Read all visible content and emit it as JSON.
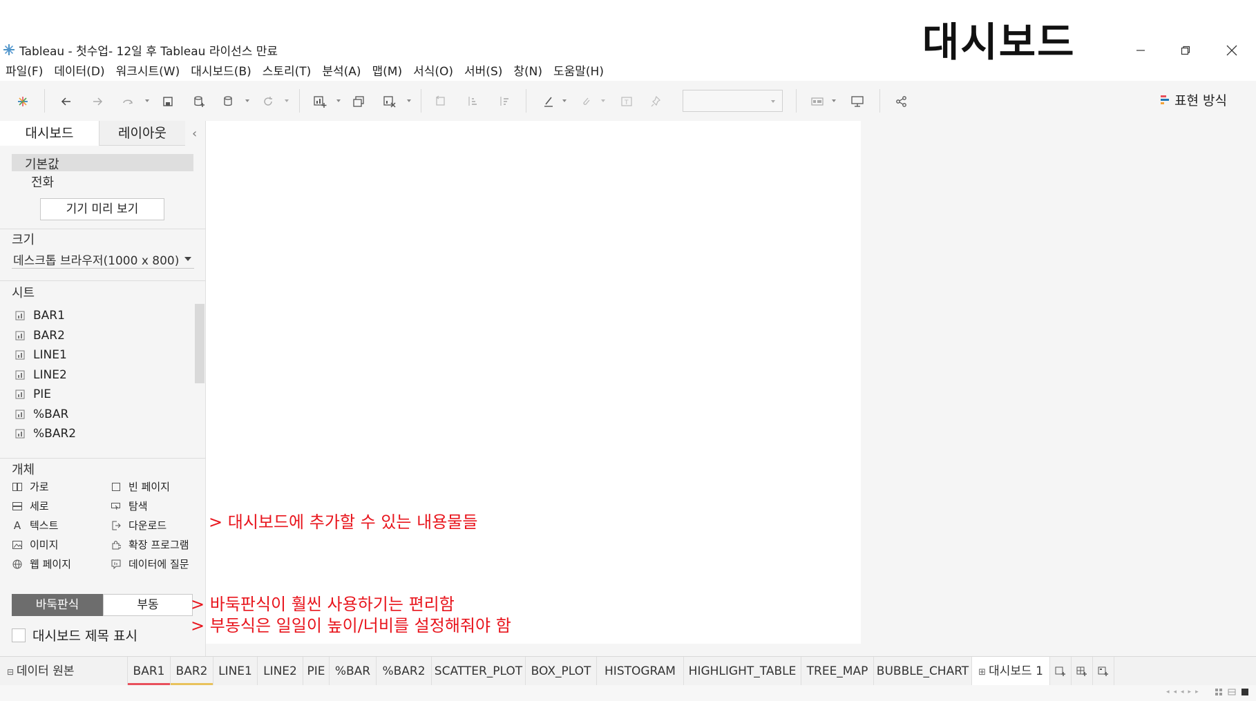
{
  "window": {
    "title": "Tableau - 첫수업- 12일 후 Tableau 라이선스 만료",
    "heading": "대시보드",
    "icons": [
      "tableau-logo-icon",
      "minimize-icon",
      "restore-icon",
      "close-icon"
    ]
  },
  "menu": [
    "파일(F)",
    "데이터(D)",
    "워크시트(W)",
    "대시보드(B)",
    "스토리(T)",
    "분석(A)",
    "맵(M)",
    "서식(O)",
    "서버(S)",
    "창(N)",
    "도움말(H)"
  ],
  "toolbar": {
    "show_me": "표현 방식"
  },
  "left_panel": {
    "tabs": [
      "대시보드",
      "레이아웃"
    ],
    "device_default": "기본값",
    "device_phone": "전화",
    "device_preview": "기기 미리 보기",
    "size_label": "크기",
    "size_value": "데스크톱 브라우저(1000 x 800)",
    "sheets_label": "시트",
    "sheets": [
      "BAR1",
      "BAR2",
      "LINE1",
      "LINE2",
      "PIE",
      "%BAR",
      "%BAR2"
    ],
    "objects_label": "개체",
    "objects": [
      {
        "label": "가로",
        "icon": "horizontal-container-icon"
      },
      {
        "label": "빈 페이지",
        "icon": "blank-icon"
      },
      {
        "label": "세로",
        "icon": "vertical-container-icon"
      },
      {
        "label": "탐색",
        "icon": "navigation-icon"
      },
      {
        "label": "텍스트",
        "icon": "text-icon"
      },
      {
        "label": "다운로드",
        "icon": "download-icon"
      },
      {
        "label": "이미지",
        "icon": "image-icon"
      },
      {
        "label": "확장 프로그램",
        "icon": "extension-icon"
      },
      {
        "label": "웹 페이지",
        "icon": "web-page-icon"
      },
      {
        "label": "데이터에 질문",
        "icon": "ask-data-icon"
      }
    ],
    "tiled": "바둑판식",
    "floating": "부동",
    "show_title": "대시보드 제목 표시"
  },
  "annotations": [
    "> 대시보드에 추가할 수 있는 내용물들",
    "> 바둑판식이 훨씬 사용하기는 편리함",
    "> 부동식은 일일이 높이/너비를 설정해줘야 함"
  ],
  "annotation_color": "#e8141c",
  "bottom_tabs": {
    "data_source": "데이터 원본",
    "sheets": [
      {
        "label": "BAR1",
        "accent": "#e8505b"
      },
      {
        "label": "BAR2",
        "accent": "#e8c25b"
      },
      {
        "label": "LINE1"
      },
      {
        "label": "LINE2"
      },
      {
        "label": "PIE"
      },
      {
        "label": "%BAR"
      },
      {
        "label": "%BAR2"
      },
      {
        "label": "SCATTER_PLOT"
      },
      {
        "label": "BOX_PLOT"
      },
      {
        "label": "HISTOGRAM"
      },
      {
        "label": "HIGHLIGHT_TABLE"
      },
      {
        "label": "TREE_MAP"
      },
      {
        "label": "BUBBLE_CHART"
      }
    ],
    "dashboard": "대시보드 1"
  }
}
